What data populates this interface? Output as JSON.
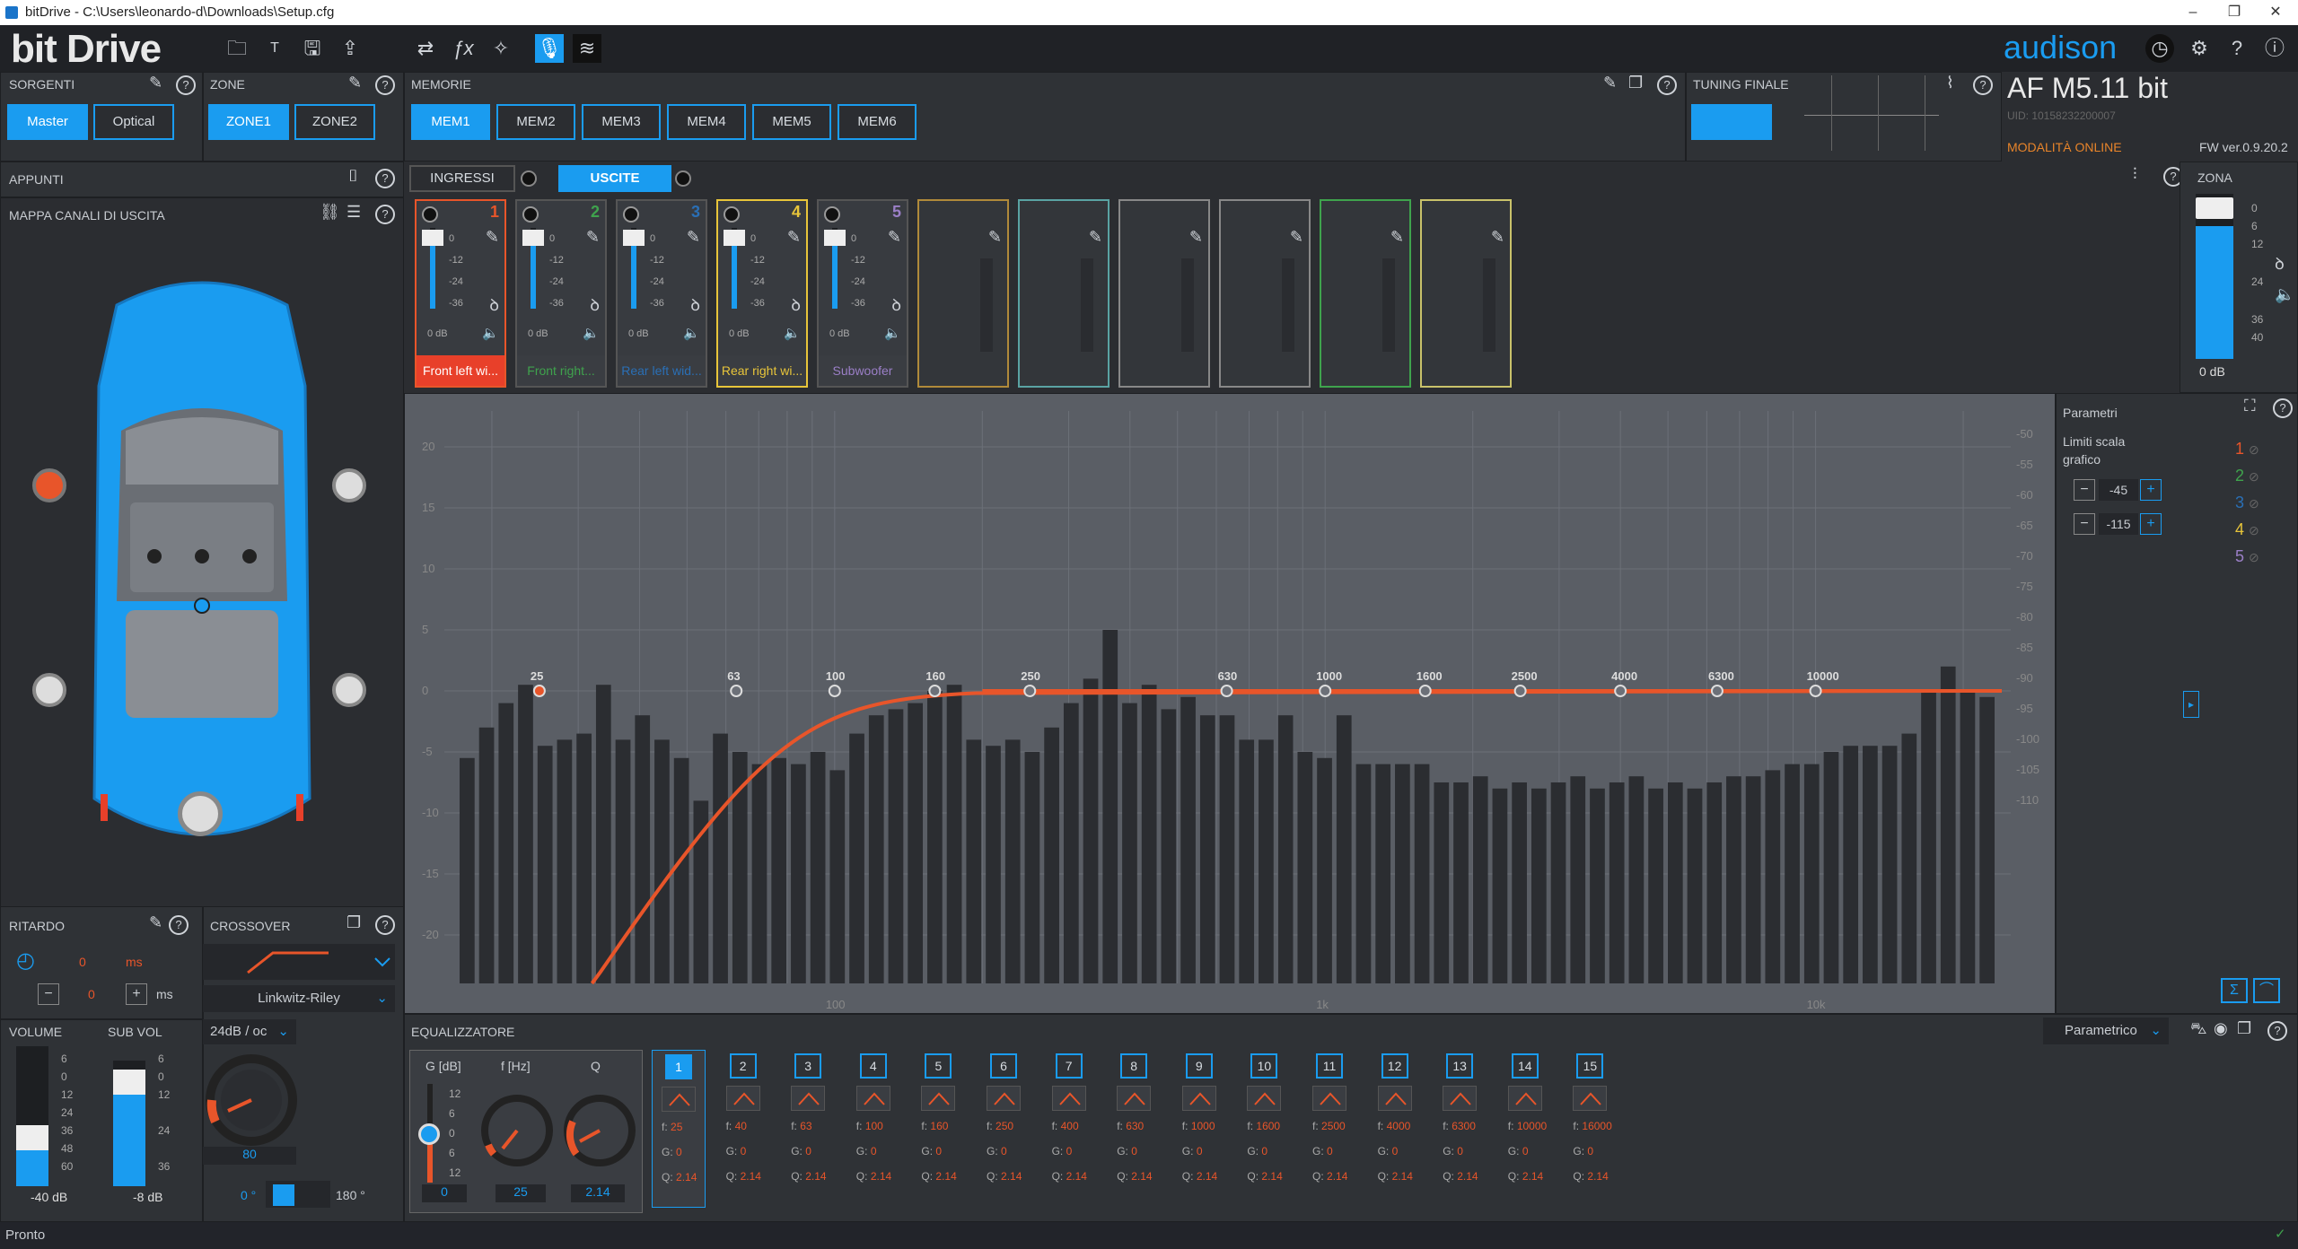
{
  "window": {
    "title": "bitDrive - C:\\Users\\leonardo-d\\Downloads\\Setup.cfg"
  },
  "app": {
    "logo": "bit Drive",
    "brand": "audison",
    "device": "AF M5.11 bit",
    "uid": "UID: 10158232200007",
    "mode": "MODALITÀ ONLINE",
    "fw": "FW ver.0.9.20.2"
  },
  "sorgenti": {
    "title": "SORGENTI",
    "items": [
      "Master",
      "Optical"
    ],
    "active": "Master"
  },
  "zone": {
    "title": "ZONE",
    "items": [
      "ZONE1",
      "ZONE2"
    ],
    "active": "ZONE1"
  },
  "memorie": {
    "title": "MEMORIE",
    "items": [
      "MEM1",
      "MEM2",
      "MEM3",
      "MEM4",
      "MEM5",
      "MEM6"
    ],
    "active": "MEM1"
  },
  "tuning": {
    "title": "TUNING FINALE"
  },
  "appunti": {
    "title": "APPUNTI"
  },
  "mappa": {
    "title": "MAPPA CANALI DI USCITA"
  },
  "io_tabs": {
    "ingressi": "INGRESSI",
    "uscite": "USCITE"
  },
  "channels": [
    {
      "num": "1",
      "name": "Front left wi...",
      "color": "#e8552a",
      "db": "0 dB"
    },
    {
      "num": "2",
      "name": "Front right...",
      "color": "#3fa34d",
      "db": "0 dB"
    },
    {
      "num": "3",
      "name": "Rear left wid...",
      "color": "#2a6fb5",
      "db": "0 dB"
    },
    {
      "num": "4",
      "name": "Rear right wi...",
      "color": "#e8c53a",
      "db": "0 dB"
    },
    {
      "num": "5",
      "name": "Subwoofer",
      "color": "#9b7fc7",
      "db": "0 dB"
    }
  ],
  "channel_scale": [
    "0",
    "-12",
    "-24",
    "-36"
  ],
  "zona": {
    "title": "ZONA",
    "scale": [
      "0",
      "6",
      "12",
      "24",
      "36",
      "40"
    ],
    "value": "0 dB"
  },
  "parametri": {
    "title": "Parametri",
    "limiti": "Limiti scala grafico",
    "max": "-45",
    "min": "-115",
    "legend": [
      "1",
      "2",
      "3",
      "4",
      "5"
    ]
  },
  "graph": {
    "y_left": [
      "20",
      "15",
      "10",
      "5",
      "0",
      "-5",
      "-10",
      "-15",
      "-20"
    ],
    "y_right": [
      "-50",
      "-55",
      "-60",
      "-65",
      "-70",
      "-75",
      "-80",
      "-85",
      "-90",
      "-95",
      "-100",
      "-105",
      "-110"
    ],
    "x_ticks": [
      "100",
      "1k",
      "10k"
    ],
    "band_freqs": [
      "25",
      "63",
      "100",
      "160",
      "250",
      "630",
      "1000",
      "1600",
      "2500",
      "4000",
      "6300",
      "10000"
    ]
  },
  "ritardo": {
    "title": "RITARDO",
    "value1": "0",
    "unit1": "ms",
    "value2": "0",
    "unit2": "ms"
  },
  "crossover": {
    "title": "CROSSOVER",
    "type": "Linkwitz-Riley",
    "slope": "24dB / oc",
    "freq": "80",
    "phase_min": "0 °",
    "phase_max": "180 °"
  },
  "volume": {
    "title": "VOLUME",
    "scale": [
      "6",
      "0",
      "12",
      "24",
      "36",
      "48",
      "60"
    ],
    "value": "-40 dB"
  },
  "subvol": {
    "title": "SUB VOL",
    "scale": [
      "6",
      "0",
      "12",
      "24",
      "36"
    ],
    "value": "-8 dB"
  },
  "equalizzatore": {
    "title": "EQUALIZZATORE",
    "mode": "Parametrico",
    "g_label": "G [dB]",
    "f_label": "f [Hz]",
    "q_label": "Q",
    "g_scale": [
      "12",
      "6",
      "0",
      "6",
      "12"
    ],
    "g_value": "0",
    "f_value": "25",
    "q_value": "2.14",
    "bands": [
      {
        "n": "1",
        "f": "25"
      },
      {
        "n": "2",
        "f": "40"
      },
      {
        "n": "3",
        "f": "63"
      },
      {
        "n": "4",
        "f": "100"
      },
      {
        "n": "5",
        "f": "160"
      },
      {
        "n": "6",
        "f": "250"
      },
      {
        "n": "7",
        "f": "400"
      },
      {
        "n": "8",
        "f": "630"
      },
      {
        "n": "9",
        "f": "1000"
      },
      {
        "n": "10",
        "f": "1600"
      },
      {
        "n": "11",
        "f": "2500"
      },
      {
        "n": "12",
        "f": "4000"
      },
      {
        "n": "13",
        "f": "6300"
      },
      {
        "n": "14",
        "f": "10000"
      },
      {
        "n": "15",
        "f": "16000"
      }
    ],
    "g_band": "0",
    "q_band": "2.14"
  },
  "status": {
    "text": "Pronto"
  },
  "colors": {
    "accent": "#1a9cf0",
    "curve": "#e8552a"
  }
}
